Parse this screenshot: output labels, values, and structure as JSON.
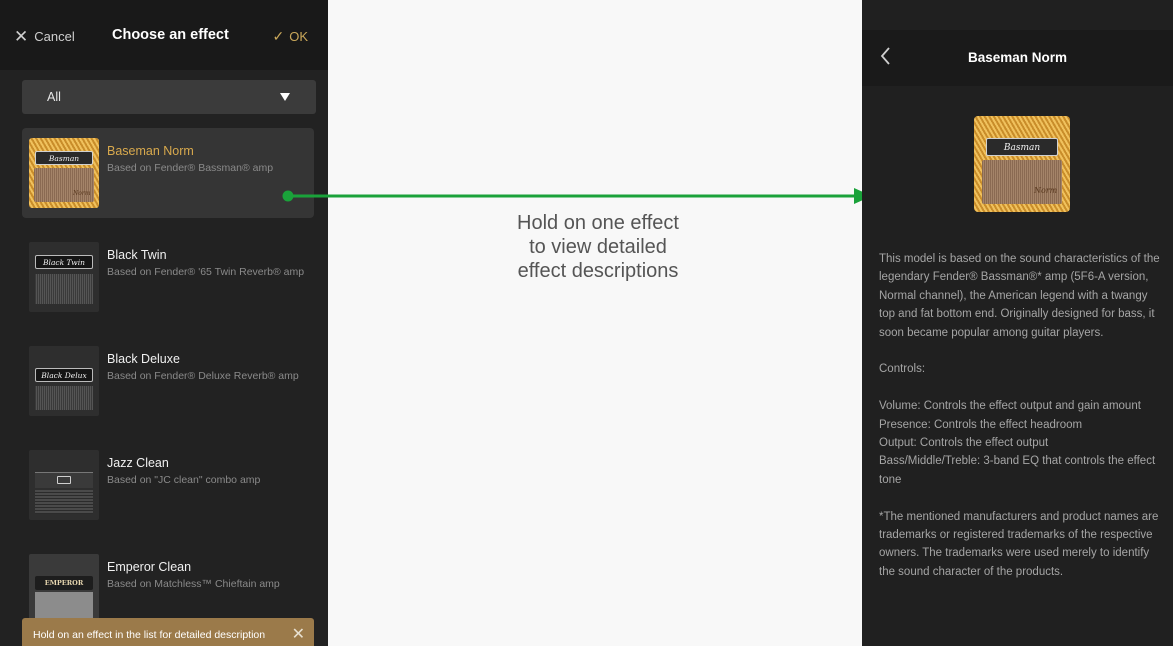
{
  "left_screen": {
    "header": {
      "cancel_label": "Cancel",
      "title": "Choose an effect",
      "ok_label": "OK"
    },
    "filter": {
      "selected": "All"
    },
    "effects": [
      {
        "name": "Baseman Norm",
        "description": "Based on Fender® Bassman® amp",
        "plate_text": "Basman",
        "sub_text": "Norm",
        "selected": true
      },
      {
        "name": "Black Twin",
        "description": "Based on Fender® '65 Twin Reverb® amp",
        "plate_text": "Black Twin",
        "selected": false
      },
      {
        "name": "Black Deluxe",
        "description": "Based on Fender® Deluxe Reverb® amp",
        "plate_text": "Black Delux",
        "selected": false
      },
      {
        "name": "Jazz Clean",
        "description": "Based on \"JC clean\" combo amp",
        "plate_text": "",
        "selected": false
      },
      {
        "name": "Emperor Clean",
        "description": "Based on Matchless™ Chieftain amp",
        "plate_text": "EMPEROR",
        "selected": false
      }
    ],
    "hint": {
      "text": "Hold on an effect in the list for detailed description"
    }
  },
  "annotation": {
    "caption": "Hold on one effect to view detailed effect descriptions",
    "arrow_color": "#1aa23a"
  },
  "right_screen": {
    "header": {
      "title": "Baseman Norm"
    },
    "image": {
      "plate_text": "Basman",
      "sub_text": "Norm"
    },
    "description": {
      "intro": "This model is based on the sound characteristics of the legendary Fender® Bassman®* amp (5F6-A version, Normal channel), the American legend with a twangy top and fat bottom end. Originally designed for bass, it soon became popular among guitar players.",
      "controls_heading": "Controls:",
      "controls": [
        "Volume: Controls the effect output and gain amount",
        "Presence: Controls the effect headroom",
        "Output: Controls the effect output",
        "Bass/Middle/Treble: 3-band EQ that controls the effect tone"
      ],
      "disclaimer": "*The mentioned manufacturers and product names are trademarks or registered trademarks of the respective owners. The trademarks were used merely to identify the sound character of the products."
    }
  },
  "colors": {
    "accent_gold": "#c9a75a",
    "selected_name": "#d8a94d",
    "hint_bar": "#9b7a4a",
    "arrow_green": "#1aa23a"
  }
}
